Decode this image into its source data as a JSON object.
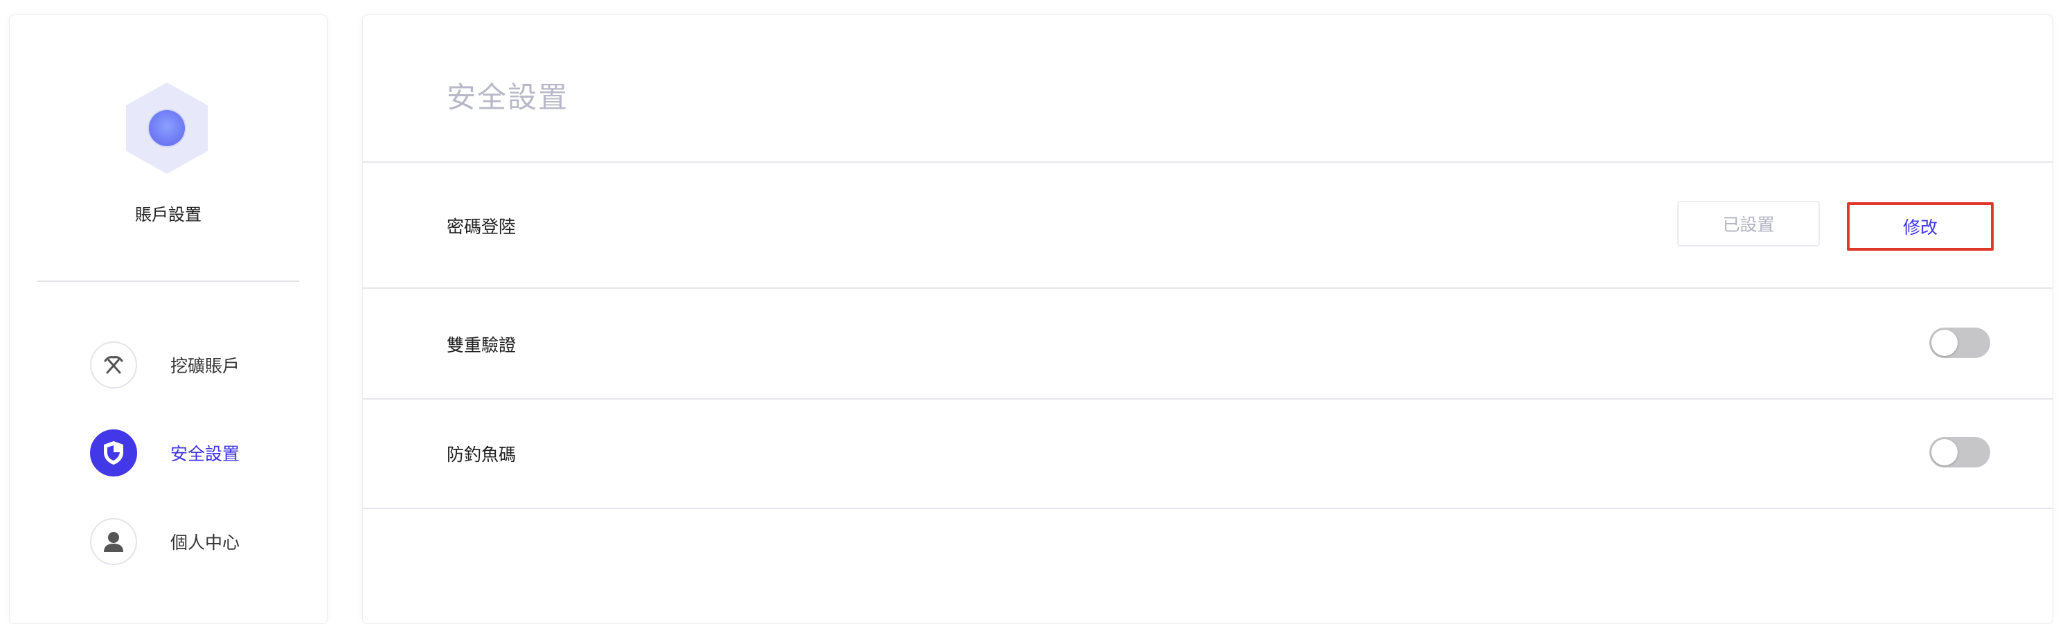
{
  "sidebar": {
    "title": "賬戶設置",
    "items": [
      {
        "label": "挖礦賬戶",
        "icon": "pickaxe-icon",
        "active": false
      },
      {
        "label": "安全設置",
        "icon": "shield-icon",
        "active": true
      },
      {
        "label": "個人中心",
        "icon": "user-icon",
        "active": false
      }
    ]
  },
  "main": {
    "title": "安全設置",
    "rows": [
      {
        "label": "密碼登陸",
        "status_label": "已設置",
        "action_label": "修改"
      },
      {
        "label": "雙重驗證",
        "toggle": false
      },
      {
        "label": "防釣魚碼",
        "toggle": false
      }
    ]
  },
  "colors": {
    "accent": "#4338e8",
    "highlight_border": "#e1362a",
    "title_muted": "#b8b8c8",
    "toggle_off": "#c6c6c8"
  }
}
